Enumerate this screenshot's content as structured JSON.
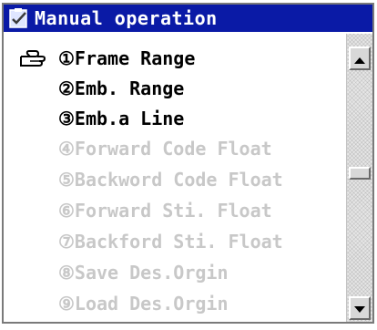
{
  "window": {
    "title": "Manual operation",
    "title_icon": "clipboard-check-icon"
  },
  "menu": {
    "pointer_icon": "pointing-hand-icon",
    "selected_index": 0,
    "items": [
      {
        "label": "①Frame Range",
        "enabled": true
      },
      {
        "label": "②Emb. Range",
        "enabled": true
      },
      {
        "label": "③Emb.a Line",
        "enabled": true
      },
      {
        "label": "④Forward Code Float",
        "enabled": false
      },
      {
        "label": "⑤Backword Code Float",
        "enabled": false
      },
      {
        "label": "⑥Forward Sti. Float",
        "enabled": false
      },
      {
        "label": "⑦Backford Sti. Float",
        "enabled": false
      },
      {
        "label": "⑧Save Des.Orgin",
        "enabled": false
      },
      {
        "label": "⑨Load Des.Orgin",
        "enabled": false
      }
    ]
  },
  "scrollbar": {
    "up_icon": "arrow-up-icon",
    "down_icon": "arrow-down-icon"
  },
  "colors": {
    "titlebar": "#0a1aa6",
    "title_text": "#ffffff",
    "enabled_text": "#000000",
    "disabled_text": "#c8c8c8"
  }
}
